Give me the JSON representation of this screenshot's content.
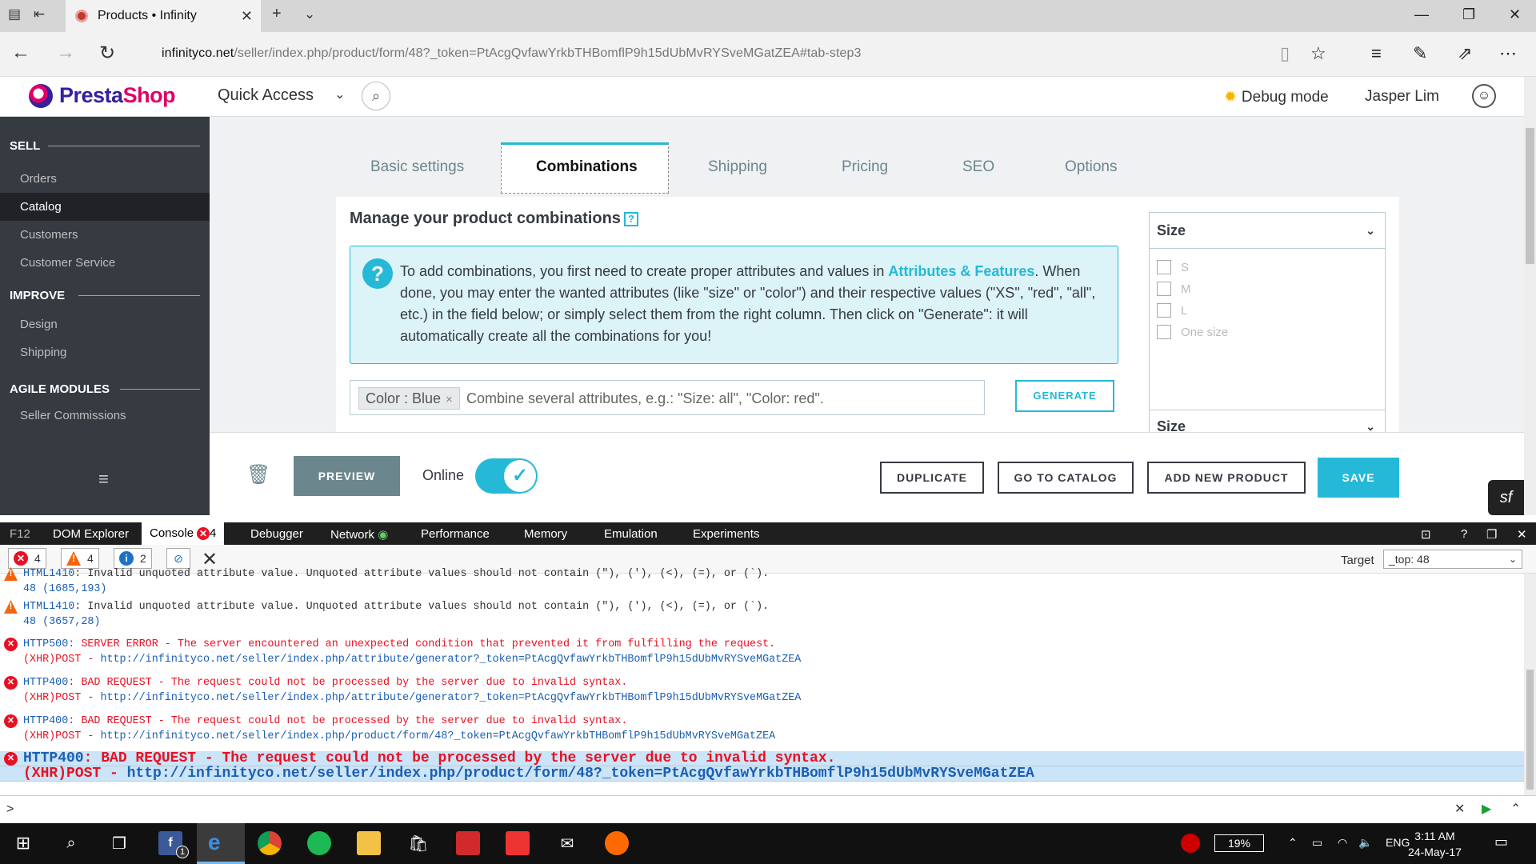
{
  "browser": {
    "tab_title": "Products • Infinity",
    "url_domain": "infinityco.net",
    "url_path": "/seller/index.php/product/form/48?_token=PtAcgQvfawYrkbTHBomflP9h15dUbMvRYSveMGatZEA#tab-step3"
  },
  "header": {
    "logo_main": "Presta",
    "logo_accent": "Shop",
    "quick_access": "Quick Access",
    "debug_mode": "Debug mode",
    "user_name": "Jasper Lim"
  },
  "sidebar": {
    "sections": [
      {
        "title": "SELL",
        "items": [
          "Orders",
          "Catalog",
          "Customers",
          "Customer Service"
        ]
      },
      {
        "title": "IMPROVE",
        "items": [
          "Design",
          "Shipping"
        ]
      },
      {
        "title": "AGILE MODULES",
        "items": [
          "Seller Commissions"
        ]
      }
    ],
    "active_item": "Catalog"
  },
  "product_tabs": [
    "Basic settings",
    "Combinations",
    "Shipping",
    "Pricing",
    "SEO",
    "Options"
  ],
  "active_product_tab": "Combinations",
  "combinations": {
    "heading": "Manage your product combinations",
    "help_icon": "?",
    "alert_pre": "To add combinations, you first need to create proper attributes and values in ",
    "alert_link": "Attributes & Features",
    "alert_post": ". When done, you may enter the wanted attributes (like \"size\" or \"color\") and their respective values (\"XS\", \"red\", \"all\", etc.) in the field below; or simply select them from the right column. Then click on \"Generate\": it will automatically create all the combinations for you!",
    "chip": "Color : Blue",
    "chip_remove": "×",
    "input_placeholder": "Combine several attributes, e.g.: \"Size: all\", \"Color: red\".",
    "generate_label": "GENERATE"
  },
  "attribute_panel": {
    "select_label": "Size",
    "options": [
      "S",
      "M",
      "L",
      "One size"
    ],
    "second_select_label": "Size"
  },
  "footer": {
    "preview": "PREVIEW",
    "online_label": "Online",
    "online_on": true,
    "duplicate": "DUPLICATE",
    "go_to_catalog": "GO TO CATALOG",
    "add_new_product": "ADD NEW PRODUCT",
    "save": "SAVE"
  },
  "devtools": {
    "f12": "F12",
    "tabs": [
      "DOM Explorer",
      "Console",
      "Debugger",
      "Network",
      "Performance",
      "Memory",
      "Emulation",
      "Experiments"
    ],
    "console_error_count": "4",
    "filters": {
      "errors": "4",
      "warnings": "4",
      "info": "2"
    },
    "target_label": "Target",
    "target_value": "_top: 48",
    "lines": [
      {
        "type": "warn",
        "code": "HTML1410",
        "msg": ": Invalid unquoted attribute value. Unquoted attribute values should not contain (\"), ('), (<), (=), or (`).",
        "loc": "48 (1685,193)"
      },
      {
        "type": "warn",
        "code": "HTML1410",
        "msg": ": Invalid unquoted attribute value. Unquoted attribute values should not contain (\"), ('), (<), (=), or (`).",
        "loc": "48 (3657,28)"
      },
      {
        "type": "err",
        "code": "HTTP500",
        "msg": ": SERVER ERROR - The server encountered an unexpected condition that prevented it from fulfilling the request.",
        "method": "(XHR)POST - ",
        "link": "http://infinityco.net/seller/index.php/attribute/generator?_token=PtAcgQvfawYrkbTHBomflP9h15dUbMvRYSveMGatZEA"
      },
      {
        "type": "err",
        "code": "HTTP400",
        "msg": ": BAD REQUEST - The request could not be processed by the server due to invalid syntax.",
        "method": "(XHR)POST - ",
        "link": "http://infinityco.net/seller/index.php/attribute/generator?_token=PtAcgQvfawYrkbTHBomflP9h15dUbMvRYSveMGatZEA"
      },
      {
        "type": "err",
        "code": "HTTP400",
        "msg": ": BAD REQUEST - The request could not be processed by the server due to invalid syntax.",
        "method": "(XHR)POST - ",
        "link": "http://infinityco.net/seller/index.php/product/form/48?_token=PtAcgQvfawYrkbTHBomflP9h15dUbMvRYSveMGatZEA"
      },
      {
        "type": "err",
        "code": "HTTP400",
        "msg": ": BAD REQUEST - The request could not be processed by the server due to invalid syntax.",
        "method": "(XHR)POST - ",
        "link": "http://infinityco.net/seller/index.php/product/form/48?_token=PtAcgQvfawYrkbTHBomflP9h15dUbMvRYSveMGatZEA"
      }
    ],
    "prompt": ">"
  },
  "taskbar": {
    "battery": "19%",
    "language": "ENG",
    "time": "3:11 AM",
    "date": "24-May-17",
    "facebook_badge": "1"
  },
  "colors": {
    "accent": "#25b9d7",
    "brand": "#34219e",
    "brand_accent": "#df0067",
    "sidebar": "#363a41",
    "error": "#e81123",
    "warning": "#f7630c"
  }
}
